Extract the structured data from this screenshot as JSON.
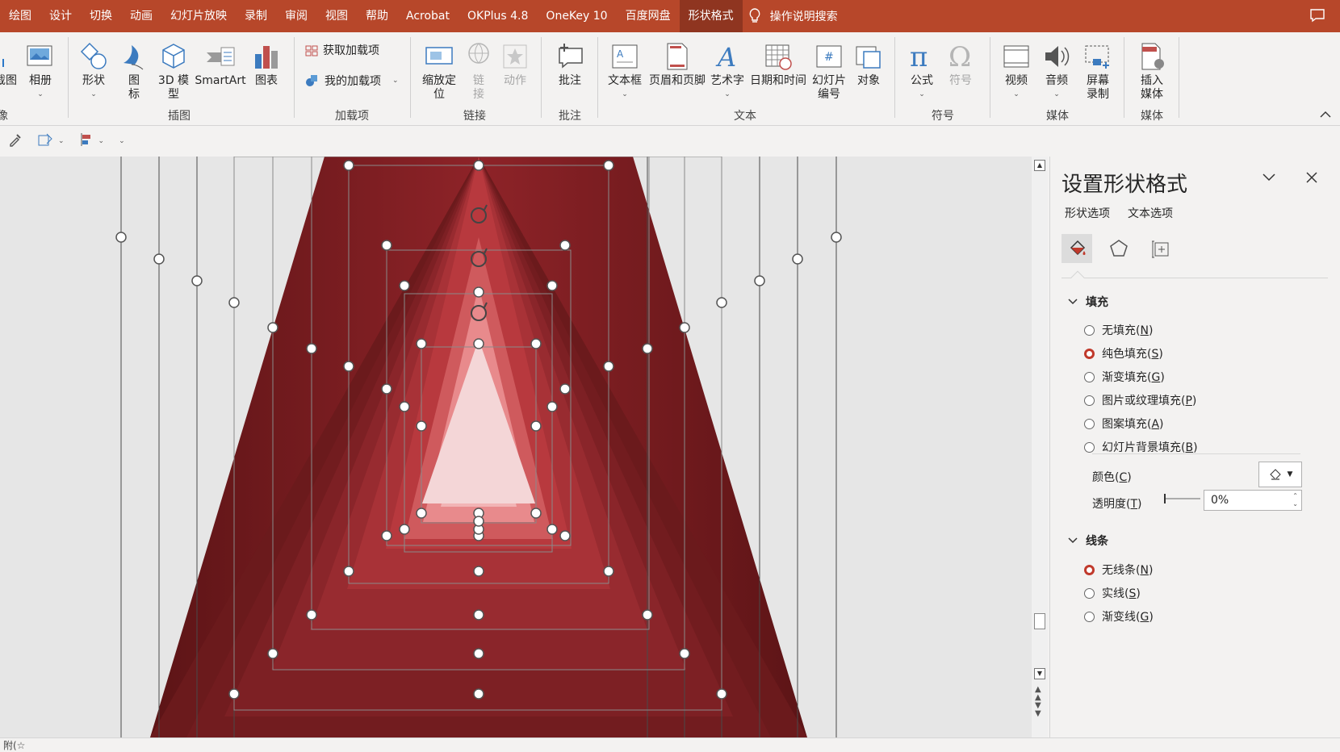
{
  "menubar": {
    "tabs": [
      "绘图",
      "设计",
      "切换",
      "动画",
      "幻灯片放映",
      "录制",
      "审阅",
      "视图",
      "帮助",
      "Acrobat",
      "OKPlus 4.8",
      "OneKey 10",
      "百度网盘",
      "形状格式"
    ],
    "active_tab": "形状格式",
    "search_label": "操作说明搜索"
  },
  "ribbon": {
    "partial_left_label": "截图",
    "partial_left_group": "像",
    "album": "相册",
    "shapes": "形状",
    "icons": "图标",
    "model3d": "3D 模型",
    "smartart": "SmartArt",
    "chart": "图表",
    "group_illustration": "插图",
    "get_addins": "获取加载项",
    "my_addins": "我的加载项",
    "group_addins": "加载项",
    "zoom": "缩放定位",
    "link": "链接",
    "action": "动作",
    "group_links": "链接",
    "comment": "批注",
    "group_comment": "批注",
    "textbox": "文本框",
    "header_footer": "页眉和页脚",
    "wordart": "艺术字",
    "datetime": "日期和时间",
    "slide_number": "幻灯片编号",
    "object": "对象",
    "group_text": "文本",
    "equation": "公式",
    "symbol": "符号",
    "group_symbols": "符号",
    "video": "视频",
    "audio": "音频",
    "screen_record": "屏幕录制",
    "group_media": "媒体",
    "insert_media": "插入媒体",
    "group_media2": "媒体"
  },
  "statusbar": {
    "text": "附(☆"
  },
  "pane": {
    "title": "设置形状格式",
    "tab_shape": "形状选项",
    "tab_text": "文本选项",
    "fill_section": "填充",
    "fill_options": [
      {
        "label": "无填充",
        "key": "N",
        "selected": false
      },
      {
        "label": "纯色填充",
        "key": "S",
        "selected": true
      },
      {
        "label": "渐变填充",
        "key": "G",
        "selected": false
      },
      {
        "label": "图片或纹理填充",
        "key": "P",
        "selected": false
      },
      {
        "label": "图案填充",
        "key": "A",
        "selected": false
      },
      {
        "label": "幻灯片背景填充",
        "key": "B",
        "selected": false
      }
    ],
    "color_label": "颜色",
    "color_key": "C",
    "transparency_label": "透明度",
    "transparency_key": "T",
    "transparency_value": "0%",
    "line_section": "线条",
    "line_options": [
      {
        "label": "无线条",
        "key": "N",
        "selected": true
      },
      {
        "label": "实线",
        "key": "S",
        "selected": false
      },
      {
        "label": "渐变线",
        "key": "G",
        "selected": false
      }
    ]
  },
  "colors": {
    "accent": "#b7472a",
    "stripe_dark": "#6b1a1c",
    "stripe_mid": "#8e2328",
    "stripe_light": "#c0393f",
    "inner_pink": "#e88a8c",
    "inner_light": "#f4d6d7"
  }
}
